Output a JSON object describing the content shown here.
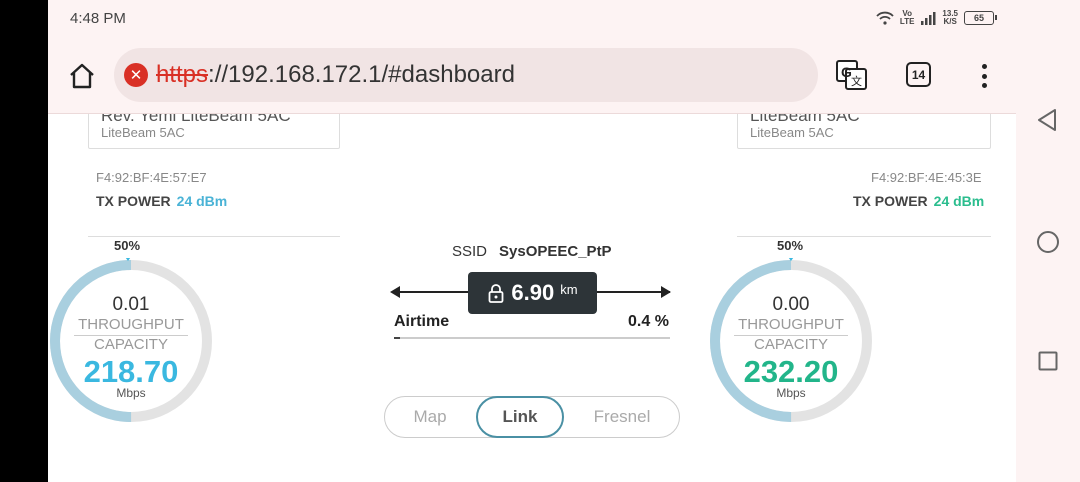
{
  "status_bar": {
    "time": "4:48 PM",
    "network_label_top": "Vo",
    "network_label_bottom": "LTE",
    "speed_top": "13.5",
    "speed_bottom": "K/S",
    "battery": "65"
  },
  "browser": {
    "url_protocol": "https",
    "url_rest": "://192.168.172.1/#dashboard",
    "tab_count": "14"
  },
  "left_device": {
    "name": "Rev. Yemi LiteBeam 5AC",
    "model": "LiteBeam 5AC",
    "mac": "F4:92:BF:4E:57:E7",
    "tx_power_label": "TX POWER",
    "tx_power_value": "24 dBm",
    "usage_pct_label": "50%",
    "usage_fraction": 0.5,
    "throughput": "0.01",
    "throughput_label": "THROUGHPUT",
    "capacity_label": "CAPACITY",
    "capacity": "218.70",
    "unit": "Mbps"
  },
  "right_device": {
    "name": "LiteBeam 5AC",
    "model": "LiteBeam 5AC",
    "mac": "F4:92:BF:4E:45:3E",
    "tx_power_label": "TX POWER",
    "tx_power_value": "24 dBm",
    "usage_pct_label": "50%",
    "usage_fraction": 0.5,
    "throughput": "0.00",
    "throughput_label": "THROUGHPUT",
    "capacity_label": "CAPACITY",
    "capacity": "232.20",
    "unit": "Mbps"
  },
  "link": {
    "ssid_label": "SSID",
    "ssid_value": "SysOPEEC_PtP",
    "distance": "6.90",
    "distance_unit": "km",
    "airtime_label": "Airtime",
    "airtime_value": "0.4 %",
    "airtime_fraction": 0.004
  },
  "view_tabs": [
    {
      "label": "Map",
      "active": false
    },
    {
      "label": "Link",
      "active": true
    },
    {
      "label": "Fresnel",
      "active": false
    }
  ],
  "colors": {
    "tx_power_left": "#4ab3d6",
    "tx_power_right": "#2bbd8e",
    "capacity_left": "#3ab8e0",
    "capacity_right": "#22b58a",
    "gauge_fill": "#a9cfdf",
    "gauge_track": "#e3e3e3",
    "chrome_bg": "#fdf3f3"
  }
}
